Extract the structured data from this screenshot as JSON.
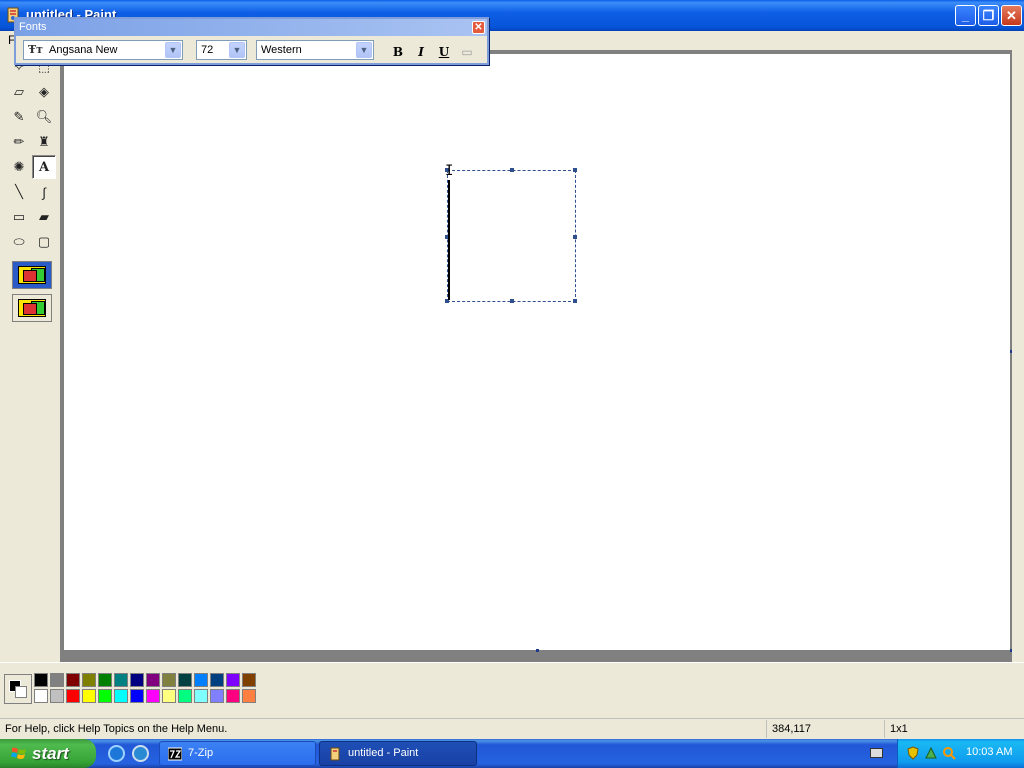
{
  "window": {
    "title": "untitled - Paint",
    "menu_first": "F"
  },
  "fonts_toolbar": {
    "title": "Fonts",
    "font_name": "Angsana New",
    "font_size": "72",
    "script": "Western",
    "bold_label": "B",
    "italic_label": "I",
    "underline_label": "U"
  },
  "tools": [
    {
      "name": "free-form-select-icon",
      "glyph": "✧"
    },
    {
      "name": "select-icon",
      "glyph": "⬚"
    },
    {
      "name": "eraser-icon",
      "glyph": "▱"
    },
    {
      "name": "fill-with-color-icon",
      "glyph": "◈"
    },
    {
      "name": "pick-color-icon",
      "glyph": "✎"
    },
    {
      "name": "magnifier-icon",
      "glyph": "🔍︎"
    },
    {
      "name": "pencil-icon",
      "glyph": "✏"
    },
    {
      "name": "brush-icon",
      "glyph": "♜"
    },
    {
      "name": "airbrush-icon",
      "glyph": "✺"
    },
    {
      "name": "text-icon",
      "glyph": "A"
    },
    {
      "name": "line-icon",
      "glyph": "╲"
    },
    {
      "name": "curve-icon",
      "glyph": "∫"
    },
    {
      "name": "rectangle-icon",
      "glyph": "▭"
    },
    {
      "name": "polygon-icon",
      "glyph": "▰"
    },
    {
      "name": "ellipse-icon",
      "glyph": "⬭"
    },
    {
      "name": "rounded-rectangle-icon",
      "glyph": "▢"
    }
  ],
  "active_tool": "text-icon",
  "palette": {
    "top": [
      "#000000",
      "#808080",
      "#800000",
      "#808000",
      "#008000",
      "#008080",
      "#000080",
      "#800080",
      "#808040",
      "#004040",
      "#0080ff",
      "#004080",
      "#8000ff",
      "#804000"
    ],
    "bottom": [
      "#ffffff",
      "#c0c0c0",
      "#ff0000",
      "#ffff00",
      "#00ff00",
      "#00ffff",
      "#0000ff",
      "#ff00ff",
      "#ffff80",
      "#00ff80",
      "#80ffff",
      "#8080ff",
      "#ff0080",
      "#ff8040"
    ]
  },
  "foreground_color": "#000000",
  "background_color": "#ffffff",
  "status": {
    "help_text": "For Help, click Help Topics on the Help Menu.",
    "coordinates": "384,117",
    "size": "1x1"
  },
  "taskbar": {
    "start_label": "start",
    "tasks": [
      {
        "label": "7-Zip",
        "active": false
      },
      {
        "label": "untitled - Paint",
        "active": true
      }
    ],
    "clock": "10:03 AM"
  }
}
